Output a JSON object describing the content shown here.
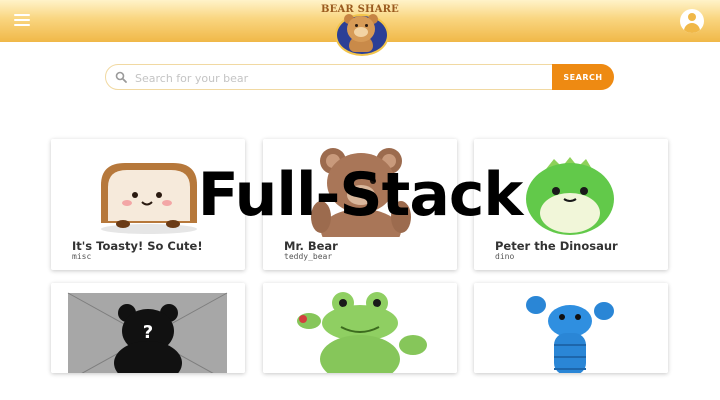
{
  "header": {
    "logo_text": "BEAR SHARE",
    "menu_icon": "hamburger-icon",
    "profile_icon": "account-circle-icon",
    "gradient_top": "#fff3c9",
    "gradient_bottom": "#f0b848"
  },
  "search": {
    "placeholder": "Search for your bear",
    "value": "",
    "button_label": "SEARCH",
    "icon": "search-icon",
    "button_color": "#ee8a12"
  },
  "cards": [
    {
      "name": "It's Toasty! So Cute!",
      "category": "misc",
      "image": "toast-plush-image"
    },
    {
      "name": "Mr. Bear",
      "category": "teddy_bear",
      "image": "brown-teddy-bear-image"
    },
    {
      "name": "Peter the Dinosaur",
      "category": "dino",
      "image": "green-dinosaur-plush-image"
    },
    {
      "name": "",
      "category": "",
      "image": "placeholder-bear-image"
    },
    {
      "name": "",
      "category": "",
      "image": "green-frog-plush-image"
    },
    {
      "name": "",
      "category": "",
      "image": "blue-lobster-plush-image"
    }
  ],
  "overlay_text": "Full-Stack"
}
